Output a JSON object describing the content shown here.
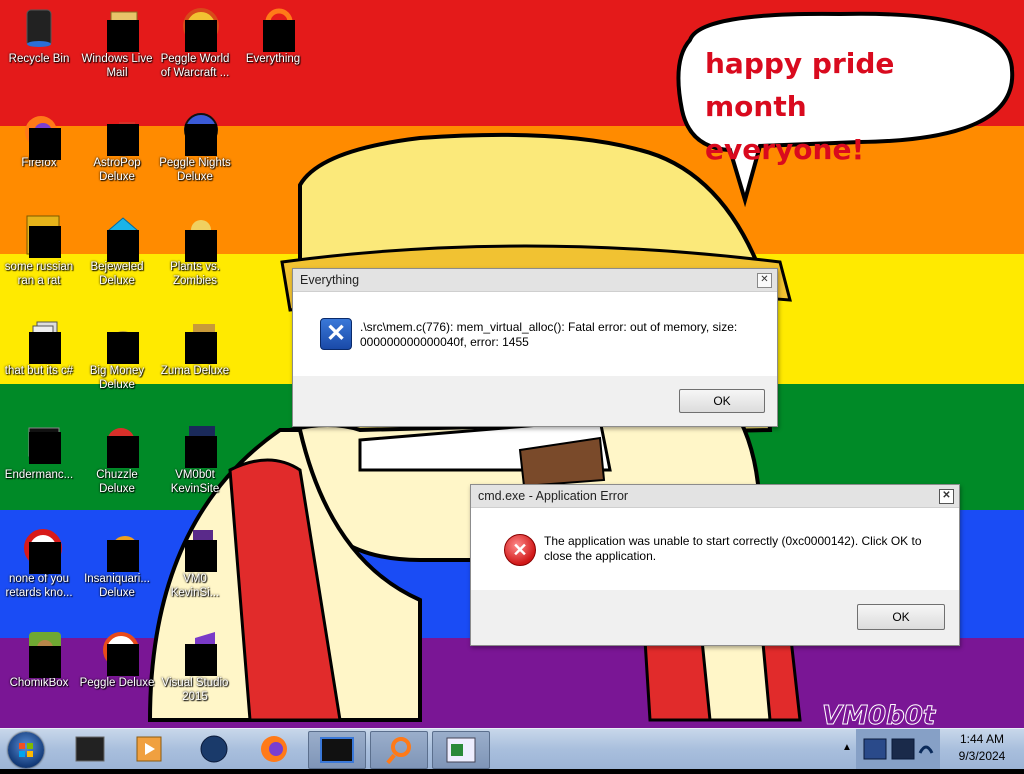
{
  "wallpaper": {
    "stripe_colors": [
      "#e41a1a",
      "#ff8b00",
      "#ffea00",
      "#008a27",
      "#1a4cf5",
      "#7a1695"
    ],
    "bubble_text": "happy pride month\neveryone!",
    "watermark": "VM0b0t"
  },
  "desktop_icons": [
    {
      "label": "Recycle Bin"
    },
    {
      "label": "Windows Live\nMail"
    },
    {
      "label": "Peggle World\nof Warcraft ..."
    },
    {
      "label": "Everything"
    },
    {
      "label": "Firefox"
    },
    {
      "label": "AstroPop\nDeluxe"
    },
    {
      "label": "Peggle Nights\nDeluxe"
    },
    {
      "label": "some russian\nran a rat"
    },
    {
      "label": "Bejeweled\nDeluxe"
    },
    {
      "label": "Plants vs.\nZombies"
    },
    {
      "label": "that but its c#"
    },
    {
      "label": "Big Money\nDeluxe"
    },
    {
      "label": "Zuma Deluxe"
    },
    {
      "label": "Endermanc..."
    },
    {
      "label": "Chuzzle\nDeluxe"
    },
    {
      "label": "VM0b0t\nKevinSite"
    },
    {
      "label": "none of you\nretards kno..."
    },
    {
      "label": "Insaniquari...\nDeluxe"
    },
    {
      "label": "VM0\nKevinSi..."
    },
    {
      "label": "ChomikBox"
    },
    {
      "label": "Peggle Deluxe"
    },
    {
      "label": "Visual Studio\n2015"
    }
  ],
  "dialog_everything": {
    "title": "Everything",
    "message": ".\\src\\mem.c(776): mem_virtual_alloc(): Fatal error: out of memory, size: 000000000000040f, error: 1455",
    "ok_label": "OK"
  },
  "dialog_cmd": {
    "title": "cmd.exe - Application Error",
    "message": "The application was unable to start correctly (0xc0000142). Click OK to close the application.",
    "ok_label": "OK"
  },
  "taskbar": {
    "pinned": [
      "explorer-icon",
      "media-player-icon",
      "globe-icon",
      "firefox-icon",
      "vm-window-icon",
      "everything-icon",
      "notepad-icon"
    ],
    "clock_time": "1:44 AM",
    "clock_date": "9/3/2024"
  }
}
